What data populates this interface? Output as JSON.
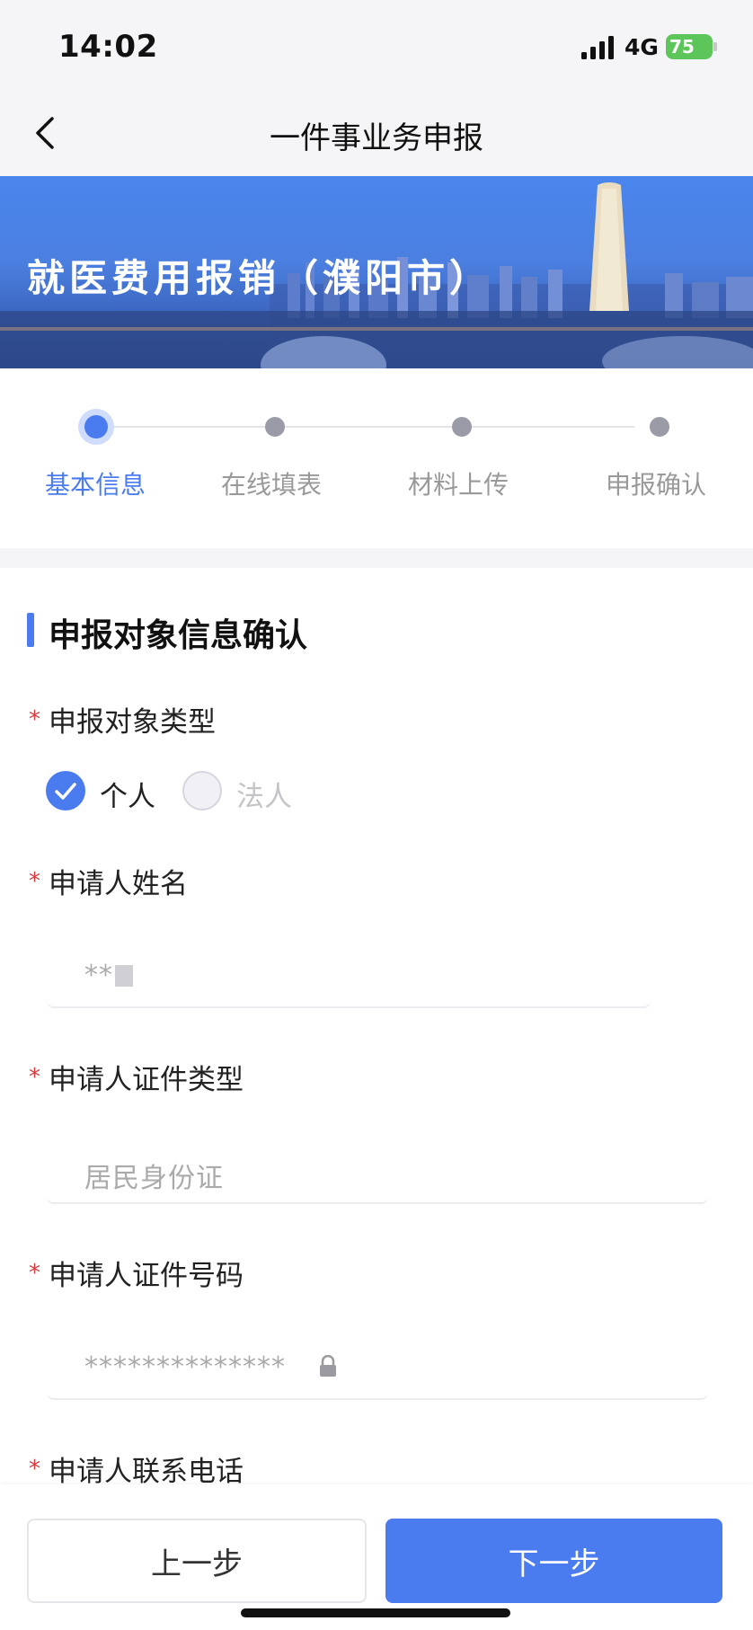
{
  "status_bar": {
    "time": "14:02",
    "network": "4G",
    "battery": "75"
  },
  "nav": {
    "title": "一件事业务申报",
    "back_icon": "chevron-left-icon"
  },
  "banner": {
    "title": "就医费用报销（濮阳市）"
  },
  "steps": [
    {
      "label": "基本信息",
      "active": true
    },
    {
      "label": "在线填表",
      "active": false
    },
    {
      "label": "材料上传",
      "active": false
    },
    {
      "label": "申报确认",
      "active": false
    }
  ],
  "section": {
    "title": "申报对象信息确认"
  },
  "fields": {
    "required_mark": "*",
    "subject_type": {
      "label": "申报对象类型",
      "options": [
        {
          "label": "个人",
          "checked": true
        },
        {
          "label": "法人",
          "checked": false
        }
      ]
    },
    "applicant_name": {
      "label": "申请人姓名",
      "value": "**"
    },
    "id_type": {
      "label": "申请人证件类型",
      "value": "居民身份证"
    },
    "id_number": {
      "label": "申请人证件号码",
      "value": "**************"
    },
    "phone": {
      "label": "申请人联系电话"
    }
  },
  "buttons": {
    "prev": "上一步",
    "next": "下一步"
  },
  "colors": {
    "accent": "#4a7cf0",
    "required": "#e0393e",
    "battery": "#5cc65a"
  }
}
